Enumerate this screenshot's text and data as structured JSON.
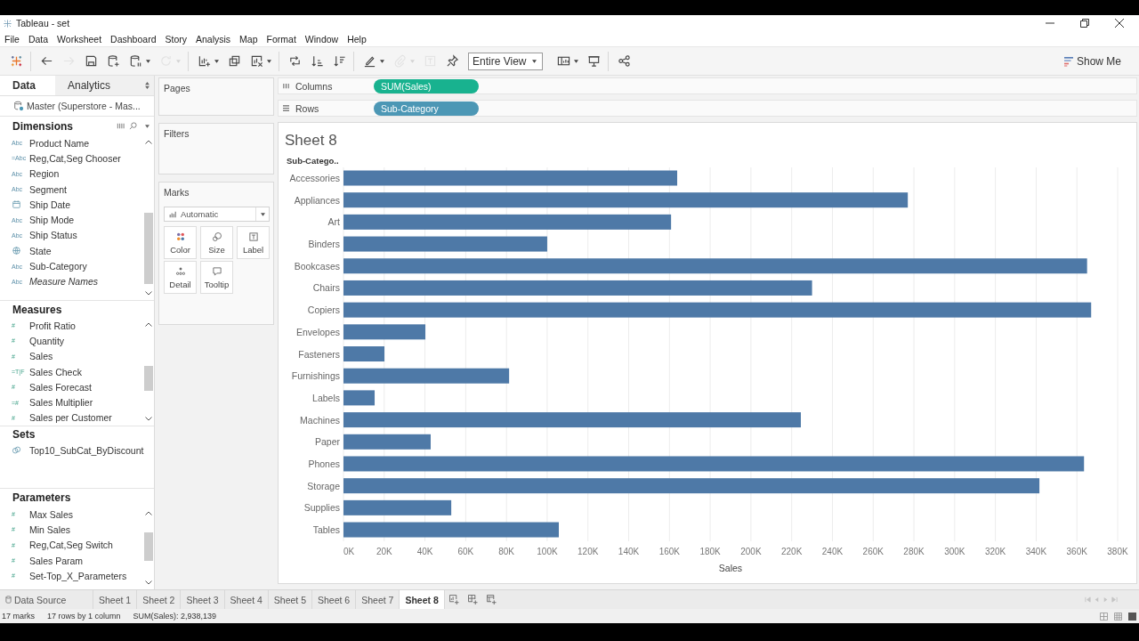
{
  "window": {
    "title": "Tableau - set"
  },
  "menu": [
    "File",
    "Data",
    "Worksheet",
    "Dashboard",
    "Story",
    "Analysis",
    "Map",
    "Format",
    "Window",
    "Help"
  ],
  "toolbar": {
    "groups": [
      {
        "tools": [
          {
            "kind": "logo",
            "disabled": false,
            "dropdown": false
          }
        ]
      },
      {
        "tools": [
          {
            "kind": "back",
            "disabled": false,
            "dropdown": false
          },
          {
            "kind": "forward",
            "disabled": true,
            "dropdown": false
          },
          {
            "kind": "save",
            "disabled": false,
            "dropdown": false
          },
          {
            "kind": "add-datasource",
            "disabled": false,
            "dropdown": false
          },
          {
            "kind": "pause-updates",
            "disabled": false,
            "dropdown": true
          },
          {
            "kind": "refresh",
            "disabled": true,
            "dropdown": true
          }
        ]
      },
      {
        "tools": [
          {
            "kind": "new-worksheet",
            "disabled": false,
            "dropdown": true
          },
          {
            "kind": "duplicate",
            "disabled": false,
            "dropdown": false
          },
          {
            "kind": "clear",
            "disabled": false,
            "dropdown": true
          }
        ]
      },
      {
        "tools": [
          {
            "kind": "swap",
            "disabled": false,
            "dropdown": false
          },
          {
            "kind": "sort-ascending",
            "disabled": false,
            "dropdown": false
          },
          {
            "kind": "sort-descending",
            "disabled": false,
            "dropdown": false
          }
        ]
      },
      {
        "tools": [
          {
            "kind": "highlight",
            "disabled": false,
            "dropdown": true
          },
          {
            "kind": "group",
            "disabled": true,
            "dropdown": true
          },
          {
            "kind": "label",
            "disabled": true,
            "dropdown": false
          },
          {
            "kind": "pin",
            "disabled": false,
            "dropdown": false
          },
          {
            "kind": "fit",
            "value": "Entire View",
            "disabled": false,
            "dropdown": true
          },
          {
            "kind": "cards",
            "disabled": false,
            "dropdown": true
          },
          {
            "kind": "presentation",
            "disabled": false,
            "dropdown": false
          }
        ]
      },
      {
        "tools": [
          {
            "kind": "share",
            "disabled": false,
            "dropdown": false
          }
        ]
      }
    ],
    "show_me": "Show Me"
  },
  "data_pane": {
    "tabs": [
      {
        "label": "Data",
        "selected": true
      },
      {
        "label": "Analytics",
        "selected": false
      }
    ],
    "datasource": "Master (Superstore - Mas...",
    "sections": [
      {
        "title": "Dimensions",
        "tools": true,
        "scrollable": true,
        "fields": [
          {
            "kind": "text",
            "glyph": "Abc",
            "name": "Product Name",
            "generated": false
          },
          {
            "kind": "text",
            "glyph": "=Abc",
            "name": "Reg,Cat,Seg Chooser",
            "generated": false
          },
          {
            "kind": "text",
            "glyph": "Abc",
            "name": "Region",
            "generated": false
          },
          {
            "kind": "text",
            "glyph": "Abc",
            "name": "Segment",
            "generated": false
          },
          {
            "kind": "date",
            "name": "Ship Date",
            "generated": false
          },
          {
            "kind": "text",
            "glyph": "Abc",
            "name": "Ship Mode",
            "generated": false
          },
          {
            "kind": "text",
            "glyph": "Abc",
            "name": "Ship Status",
            "generated": false
          },
          {
            "kind": "geo",
            "name": "State",
            "generated": false
          },
          {
            "kind": "text",
            "glyph": "Abc",
            "name": "Sub-Category",
            "generated": false
          },
          {
            "kind": "text",
            "glyph": "Abc",
            "name": "Measure Names",
            "generated": true
          }
        ]
      },
      {
        "title": "Measures",
        "tools": false,
        "scrollable": true,
        "fields": [
          {
            "kind": "number",
            "glyph": "#",
            "name": "Profit Ratio"
          },
          {
            "kind": "number",
            "glyph": "#",
            "name": "Quantity"
          },
          {
            "kind": "number",
            "glyph": "#",
            "name": "Sales"
          },
          {
            "kind": "boolean",
            "glyph": "=T|F",
            "name": "Sales Check"
          },
          {
            "kind": "number",
            "glyph": "#",
            "name": "Sales Forecast"
          },
          {
            "kind": "number",
            "glyph": "=#",
            "name": "Sales Multiplier"
          },
          {
            "kind": "number",
            "glyph": "#",
            "name": "Sales per Customer"
          }
        ]
      },
      {
        "title": "Sets",
        "tools": false,
        "scrollable": false,
        "fields": [
          {
            "kind": "set",
            "name": "Top10_SubCat_ByDiscount"
          }
        ]
      },
      {
        "title": "Parameters",
        "tools": false,
        "scrollable": true,
        "fields": [
          {
            "kind": "number",
            "glyph": "#",
            "name": "Max Sales"
          },
          {
            "kind": "number",
            "glyph": "#",
            "name": "Min Sales"
          },
          {
            "kind": "number",
            "glyph": "#",
            "name": "Reg,Cat,Seg Switch"
          },
          {
            "kind": "number",
            "glyph": "#",
            "name": "Sales Param"
          },
          {
            "kind": "number",
            "glyph": "#",
            "name": "Set-Top_X_Parameters"
          }
        ]
      }
    ]
  },
  "cards": {
    "pages": "Pages",
    "filters": "Filters",
    "marks": {
      "title": "Marks",
      "type": "Automatic",
      "buttons": [
        {
          "kind": "color",
          "label": "Color"
        },
        {
          "kind": "size",
          "label": "Size"
        },
        {
          "kind": "label",
          "label": "Label"
        },
        {
          "kind": "detail",
          "label": "Detail"
        },
        {
          "kind": "tooltip",
          "label": "Tooltip"
        }
      ]
    }
  },
  "shelves": [
    {
      "kind": "columns",
      "label": "Columns",
      "pills": [
        {
          "kind": "measure",
          "label": "SUM(Sales)"
        }
      ]
    },
    {
      "kind": "rows",
      "label": "Rows",
      "pills": [
        {
          "kind": "dimension",
          "label": "Sub-Category"
        }
      ]
    }
  ],
  "worksheet": {
    "title": "Sheet 8",
    "chart_data": {
      "type": "bar",
      "orientation": "horizontal",
      "grid": true,
      "ylabel": "Sub-Catego..",
      "xlabel": "Sales",
      "categories": [
        "Accessories",
        "Appliances",
        "Art",
        "Binders",
        "Bookcases",
        "Chairs",
        "Copiers",
        "Envelopes",
        "Fasteners",
        "Furnishings",
        "Labels",
        "Machines",
        "Paper",
        "Phones",
        "Storage",
        "Supplies",
        "Tables"
      ],
      "values": [
        163800,
        277000,
        160800,
        100000,
        365000,
        230000,
        367000,
        40200,
        20100,
        81300,
        15300,
        224500,
        42800,
        363500,
        341600,
        52900,
        105700
      ],
      "xlim": [
        0,
        380000
      ],
      "xticks": [
        {
          "value": 0,
          "label": "0K"
        },
        {
          "value": 20000,
          "label": "20K"
        },
        {
          "value": 40000,
          "label": "40K"
        },
        {
          "value": 60000,
          "label": "60K"
        },
        {
          "value": 80000,
          "label": "80K"
        },
        {
          "value": 100000,
          "label": "100K"
        },
        {
          "value": 120000,
          "label": "120K"
        },
        {
          "value": 140000,
          "label": "140K"
        },
        {
          "value": 160000,
          "label": "160K"
        },
        {
          "value": 180000,
          "label": "180K"
        },
        {
          "value": 200000,
          "label": "200K"
        },
        {
          "value": 220000,
          "label": "220K"
        },
        {
          "value": 240000,
          "label": "240K"
        },
        {
          "value": 260000,
          "label": "260K"
        },
        {
          "value": 280000,
          "label": "280K"
        },
        {
          "value": 300000,
          "label": "300K"
        },
        {
          "value": 320000,
          "label": "320K"
        },
        {
          "value": 340000,
          "label": "340K"
        },
        {
          "value": 360000,
          "label": "360K"
        },
        {
          "value": 380000,
          "label": "380K"
        }
      ]
    }
  },
  "sheet_tabs": {
    "data_source": "Data Source",
    "sheets": [
      {
        "label": "Sheet 1",
        "selected": false
      },
      {
        "label": "Sheet 2",
        "selected": false
      },
      {
        "label": "Sheet 3",
        "selected": false
      },
      {
        "label": "Sheet 4",
        "selected": false
      },
      {
        "label": "Sheet 5",
        "selected": false
      },
      {
        "label": "Sheet 6",
        "selected": false
      },
      {
        "label": "Sheet 7",
        "selected": false
      },
      {
        "label": "Sheet 8",
        "selected": true
      }
    ]
  },
  "status_bar": [
    "17 marks",
    "17 rows by 1 column",
    "SUM(Sales): 2,938,139"
  ]
}
